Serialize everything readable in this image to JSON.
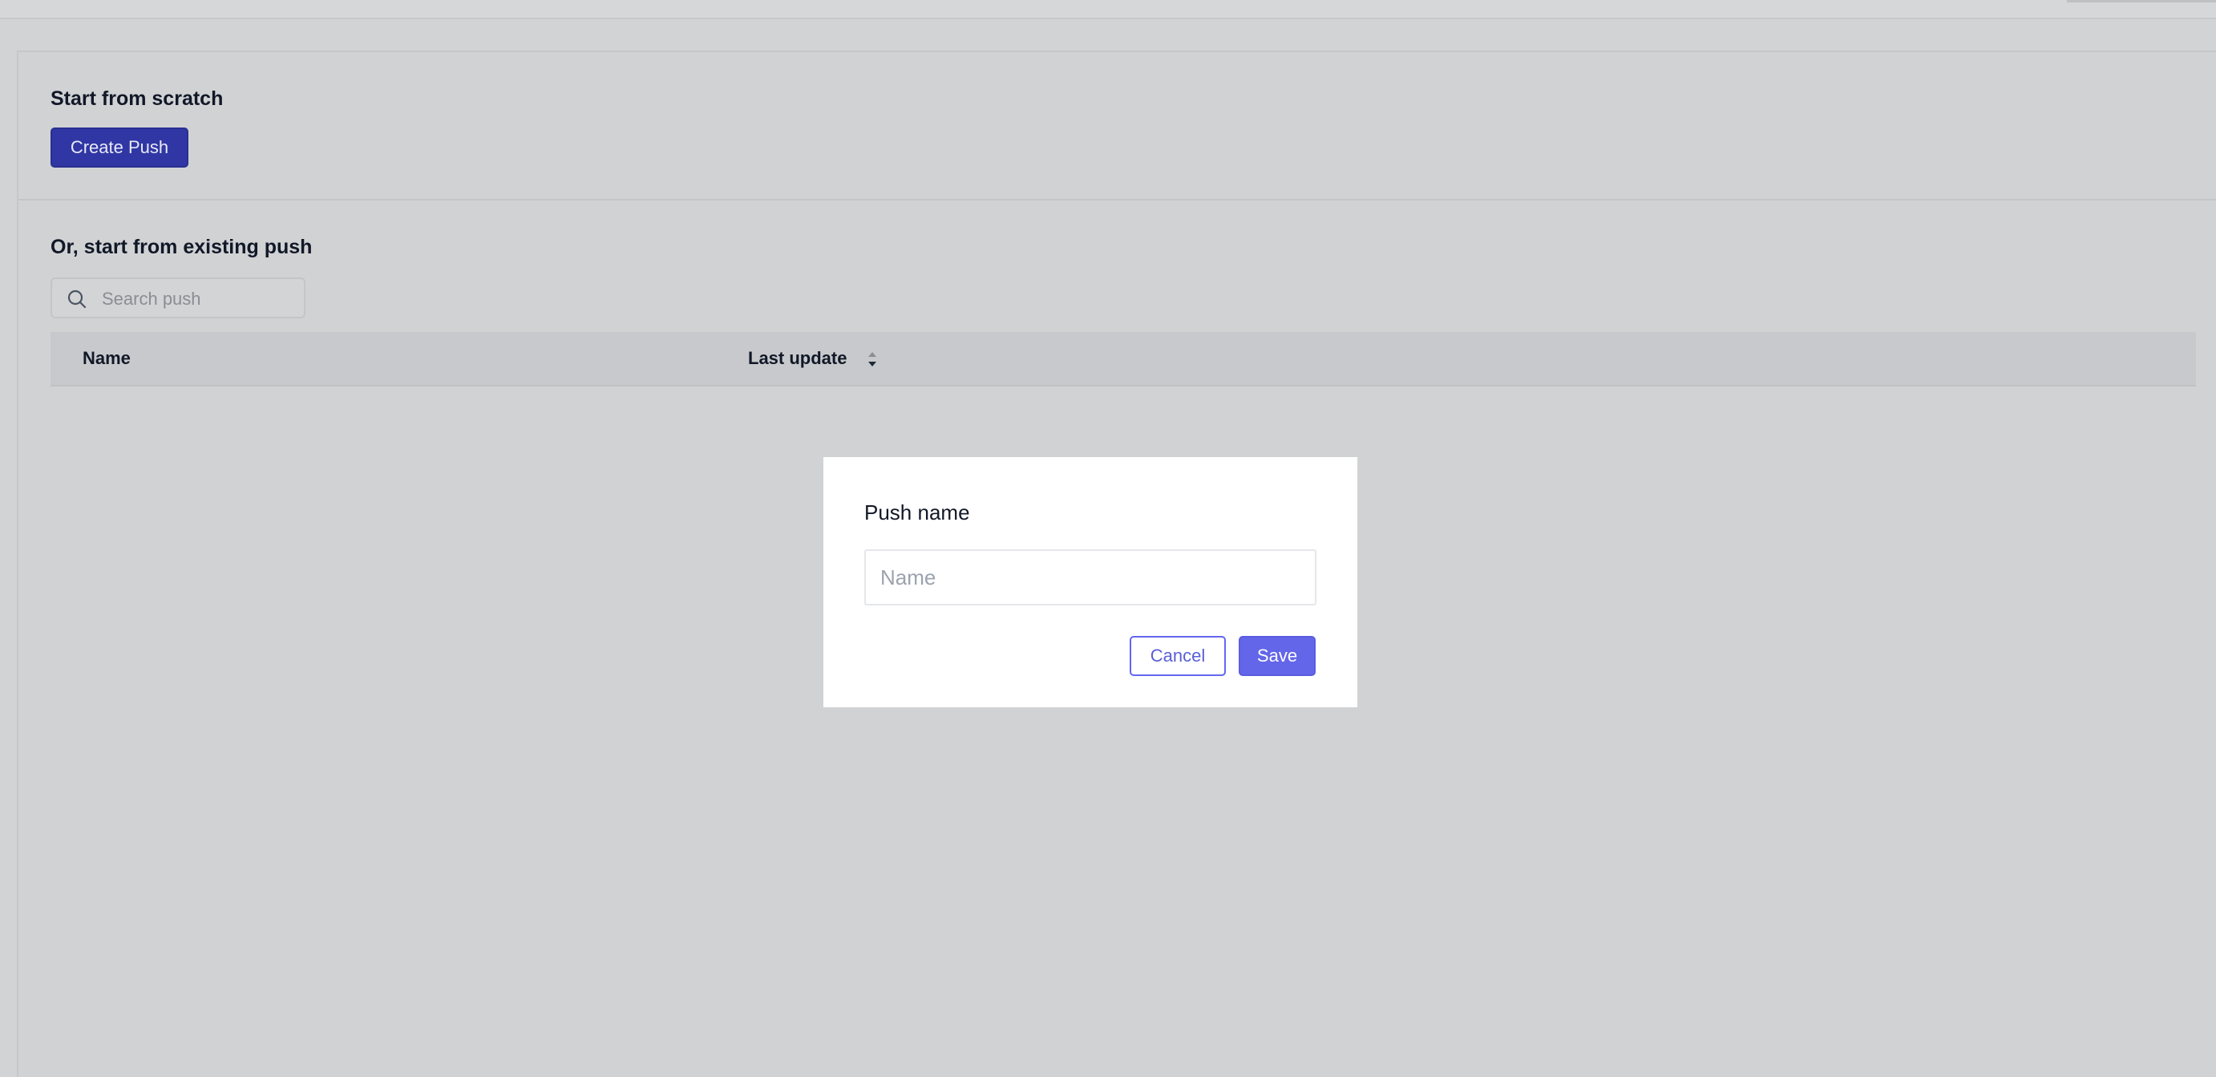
{
  "scratch_section": {
    "title": "Start from scratch",
    "create_button_label": "Create Push"
  },
  "existing_section": {
    "title": "Or, start from existing push",
    "search": {
      "placeholder": "Search push",
      "value": ""
    },
    "table": {
      "columns": [
        "Name",
        "Last update"
      ],
      "sort_icon": "sort-up-down-icon",
      "rows": []
    }
  },
  "modal": {
    "title": "Push name",
    "name_input": {
      "placeholder": "Name",
      "value": ""
    },
    "cancel_label": "Cancel",
    "save_label": "Save"
  },
  "colors": {
    "primary_dark": "#3037a4",
    "primary": "#6366e8",
    "overlay_bg": "#d2d3d5"
  }
}
